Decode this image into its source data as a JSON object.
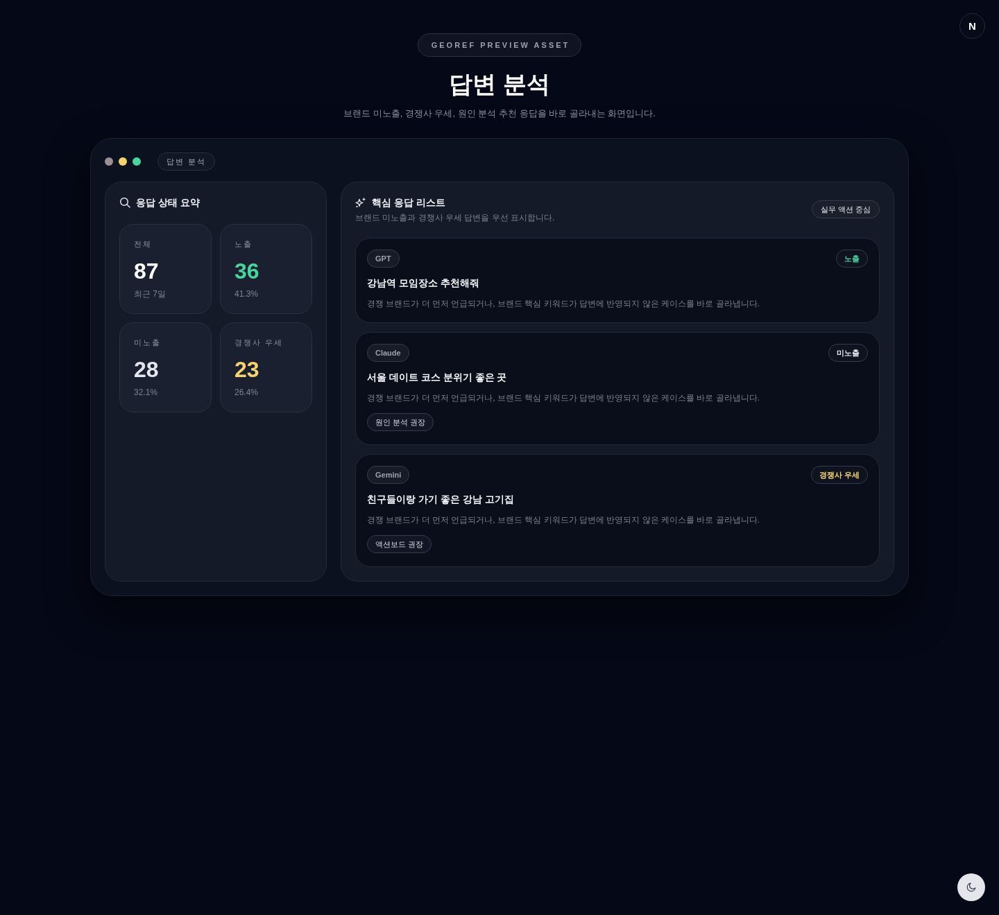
{
  "corner_badge": {
    "label": "N"
  },
  "hero": {
    "eyebrow": "GEOREF PREVIEW ASSET",
    "title": "답변 분석",
    "subtitle": "브랜드 미노출, 경쟁사 우세, 원인 분석 추천 응답을 바로 골라내는 화면입니다."
  },
  "window": {
    "dots": [
      {
        "color": "#9c8f92"
      },
      {
        "color": "#f3d46b"
      },
      {
        "color": "#45d6a0"
      }
    ],
    "tab": "답변 분석"
  },
  "summary": {
    "title": "응답 상태 요약",
    "stats": [
      {
        "label": "전체",
        "value": "87",
        "note": "최근 7일",
        "color": "#ffffff"
      },
      {
        "label": "노출",
        "value": "36",
        "note": "41.3%",
        "color": "#45d6a0"
      },
      {
        "label": "미노출",
        "value": "28",
        "note": "32.1%",
        "color": "#e4e6ee"
      },
      {
        "label": "경쟁사 우세",
        "value": "23",
        "note": "26.4%",
        "color": "#f5d46e"
      }
    ]
  },
  "responses": {
    "title": "핵심 응답 리스트",
    "subtitle": "브랜드 미노출과 경쟁사 우세 답변을 우선 표시합니다.",
    "filter": "실무 액션 중심",
    "items": [
      {
        "model": "GPT",
        "status": {
          "label": "노출",
          "color": "#45d6a0"
        },
        "question": "강남역 모임장소 추천해줘",
        "description": "경쟁 브랜드가 더 먼저 언급되거나, 브랜드 핵심 키워드가 답변에 반영되지 않은 케이스를 바로 골라냅니다."
      },
      {
        "model": "Claude",
        "status": {
          "label": "미노출",
          "color": "#e4e6ee"
        },
        "question": "서울 데이트 코스 분위기 좋은 곳",
        "description": "경쟁 브랜드가 더 먼저 언급되거나, 브랜드 핵심 키워드가 답변에 반영되지 않은 케이스를 바로 골라냅니다.",
        "action": "원인 분석 권장"
      },
      {
        "model": "Gemini",
        "status": {
          "label": "경쟁사 우세",
          "color": "#f5d46e"
        },
        "question": "친구들이랑 가기 좋은 강남 고기집",
        "description": "경쟁 브랜드가 더 먼저 언급되거나, 브랜드 핵심 키워드가 답변에 반영되지 않은 케이스를 바로 골라냅니다.",
        "action": "액션보드 권장"
      }
    ]
  }
}
